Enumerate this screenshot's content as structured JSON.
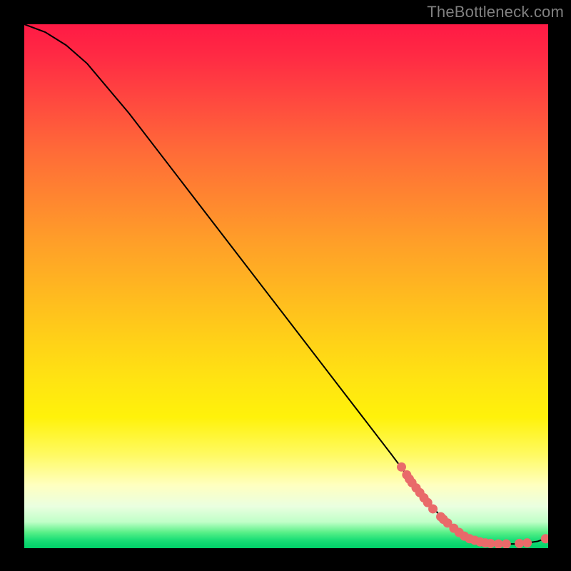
{
  "attribution": "TheBottleneck.com",
  "chart_data": {
    "type": "line",
    "title": "",
    "xlabel": "",
    "ylabel": "",
    "xlim": [
      0,
      100
    ],
    "ylim": [
      0,
      100
    ],
    "grid": false,
    "series": [
      {
        "name": "curve",
        "x": [
          0,
          4,
          8,
          12,
          20,
          30,
          40,
          50,
          60,
          70,
          76,
          80,
          83,
          86,
          88,
          90,
          92,
          94,
          96,
          98,
          100
        ],
        "y": [
          100,
          98.5,
          96,
          92.5,
          83,
          70,
          57,
          44,
          31,
          18,
          10,
          5.5,
          3,
          1.5,
          1,
          0.8,
          0.8,
          0.8,
          1,
          1.3,
          2
        ]
      }
    ],
    "markers": [
      {
        "x": 72,
        "y": 15.5
      },
      {
        "x": 73,
        "y": 14
      },
      {
        "x": 73.5,
        "y": 13.2
      },
      {
        "x": 74,
        "y": 12.5
      },
      {
        "x": 74.8,
        "y": 11.5
      },
      {
        "x": 75.5,
        "y": 10.6
      },
      {
        "x": 76.3,
        "y": 9.6
      },
      {
        "x": 77,
        "y": 8.7
      },
      {
        "x": 78,
        "y": 7.5
      },
      {
        "x": 79.5,
        "y": 6
      },
      {
        "x": 80,
        "y": 5.5
      },
      {
        "x": 80.8,
        "y": 4.8
      },
      {
        "x": 82,
        "y": 3.8
      },
      {
        "x": 83,
        "y": 3
      },
      {
        "x": 84,
        "y": 2.3
      },
      {
        "x": 85,
        "y": 1.8
      },
      {
        "x": 86,
        "y": 1.5
      },
      {
        "x": 87,
        "y": 1.2
      },
      {
        "x": 88,
        "y": 1
      },
      {
        "x": 89,
        "y": 0.9
      },
      {
        "x": 90.5,
        "y": 0.8
      },
      {
        "x": 92,
        "y": 0.8
      },
      {
        "x": 94.5,
        "y": 0.9
      },
      {
        "x": 96,
        "y": 1
      },
      {
        "x": 99.5,
        "y": 1.8
      }
    ],
    "marker_color": "#e96a6a",
    "line_color": "#000000"
  }
}
